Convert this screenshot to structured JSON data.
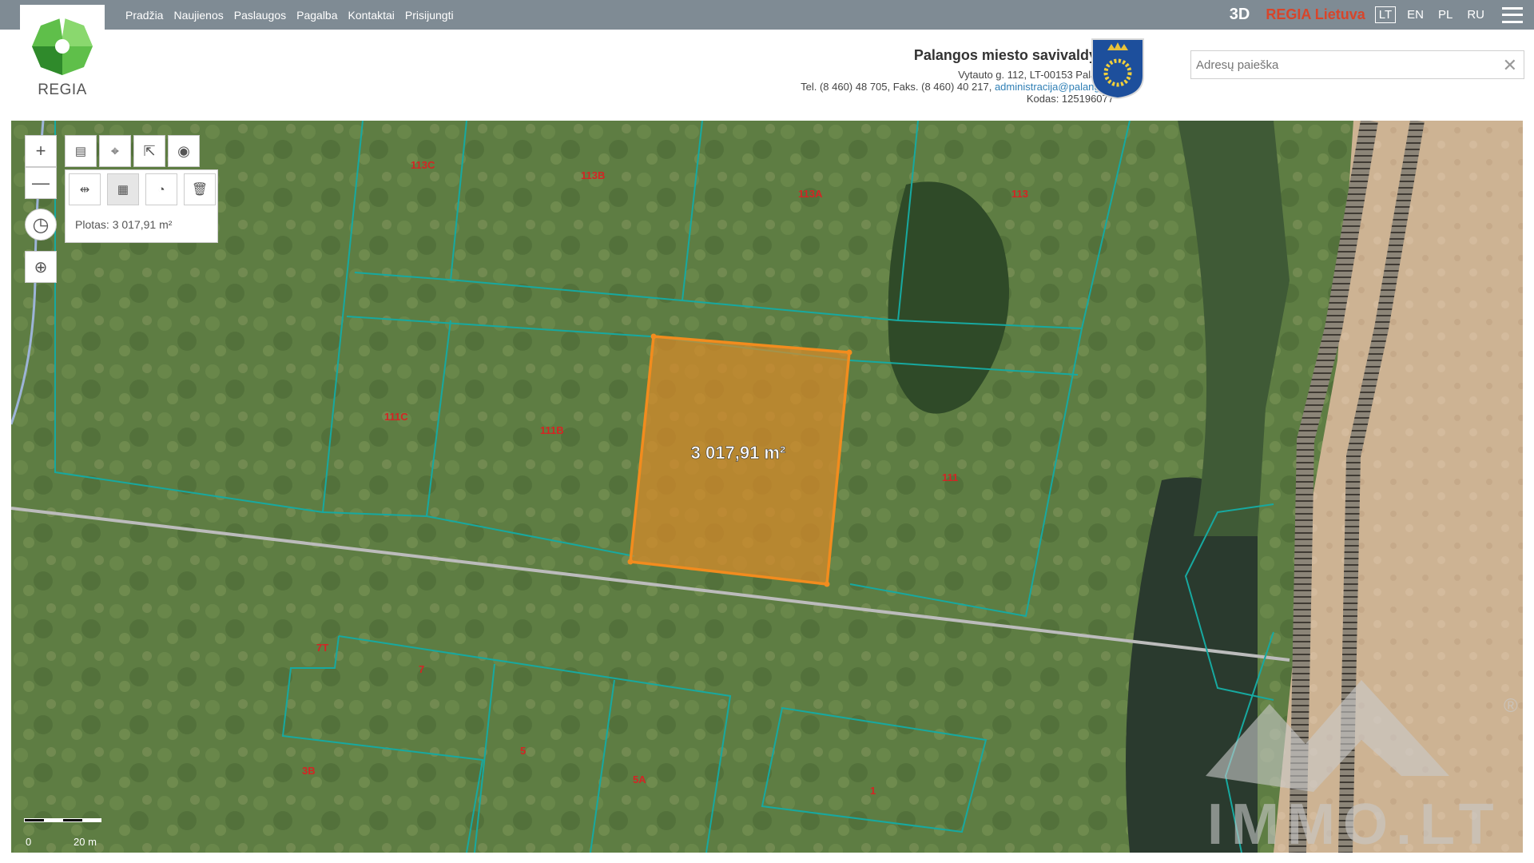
{
  "nav": [
    "Pradžia",
    "Naujienos",
    "Paslaugos",
    "Pagalba",
    "Kontaktai",
    "Prisijungti"
  ],
  "logo_text": "REGIA",
  "top_right": {
    "three_d": "3D",
    "regia_lt": "REGIA Lietuva",
    "languages": [
      "LT",
      "EN",
      "PL",
      "RU"
    ],
    "active_language": "LT"
  },
  "municipality": {
    "title": "Palangos miesto savivaldybė",
    "address": "Vytauto g. 112, LT-00153 Palanga",
    "phone": "Tel. (8 460) 48 705, Faks. (8 460) 40 217,",
    "email": "administracija@palanga.lt",
    "code": "Kodas: 125196077"
  },
  "search": {
    "placeholder": "Adresų paieška",
    "clear": "✕"
  },
  "tools": {
    "zoom_in": "+",
    "zoom_out": "—",
    "measure_result": "Plotas: 3 017,91 m²"
  },
  "map": {
    "area_label": "3 017,91 m²",
    "parcel_labels": [
      "113C",
      "113B",
      "113A",
      "113",
      "111C",
      "111B",
      "111",
      "7T",
      "7",
      "5",
      "5A",
      "3B",
      "1"
    ],
    "scale": {
      "start": "0",
      "end": "20 m"
    },
    "watermark": "IMMO.LT",
    "watermark_mark": "®"
  },
  "colors": {
    "topbar": "#7f8b94",
    "parcel_line": "#17a9a0",
    "selection": "#f28c1e",
    "parcel_label": "#d42424"
  }
}
